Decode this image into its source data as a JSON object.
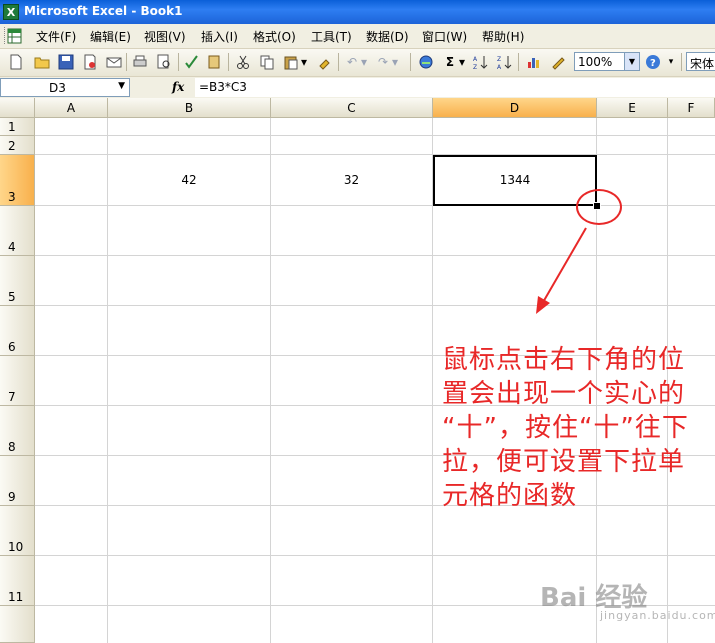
{
  "window": {
    "title": "Microsoft Excel - Book1",
    "app_icon": "X"
  },
  "menu": [
    "文件(F)",
    "编辑(E)",
    "视图(V)",
    "插入(I)",
    "格式(O)",
    "工具(T)",
    "数据(D)",
    "窗口(W)",
    "帮助(H)"
  ],
  "toolbar": {
    "zoom": "100%",
    "font": "宋体",
    "autosum": "Σ"
  },
  "formula_bar": {
    "name_box": "D3",
    "fx": "fx",
    "formula": "=B3*C3"
  },
  "sheet": {
    "columns": [
      "A",
      "B",
      "C",
      "D",
      "E",
      "F"
    ],
    "rows": [
      "1",
      "2",
      "3",
      "4",
      "5",
      "6",
      "7",
      "8",
      "9",
      "10",
      "11"
    ],
    "active_cell": "D3",
    "cells": {
      "B3": "42",
      "C3": "32",
      "D3": "1344"
    }
  },
  "annotation": {
    "lines": [
      "鼠标点击右下角的位",
      "置会出现一个实心的",
      "“十”，按住“十”往下",
      "拉，便可设置下拉单",
      "元格的函数"
    ],
    "color": "#e82828"
  },
  "watermark": {
    "text": "Bai 经验",
    "sub": "jingyan.baidu.com"
  },
  "colors": {
    "title_bar": "#1c63d8",
    "active_header": "#f8b04c",
    "grid_line": "#d4d4d4"
  }
}
